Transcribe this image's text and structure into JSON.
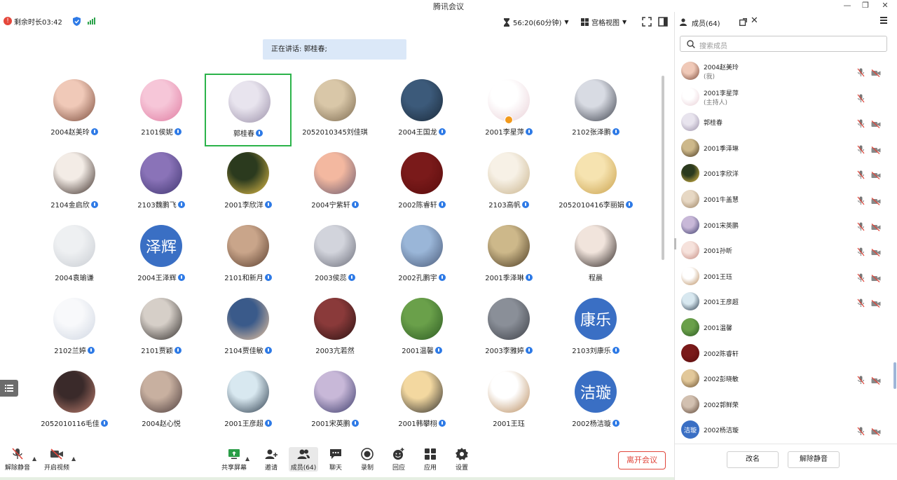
{
  "window": {
    "title": "腾讯会议"
  },
  "topbar": {
    "remaining": "剩余时长03:42",
    "duration": "56:20(60分钟)",
    "view_mode": "宫格视图"
  },
  "speaking": {
    "text": "正在讲话: 郭桂春;"
  },
  "grid": [
    {
      "name": "2004赵美玲",
      "colors": [
        "#f0c9b8",
        "#7a4a3a"
      ],
      "mic": true
    },
    {
      "name": "2101侯妮",
      "colors": [
        "#f6c6d8",
        "#e07aa0"
      ],
      "mic": true
    },
    {
      "name": "郭桂春",
      "colors": [
        "#e8e4ee",
        "#9a8fa8"
      ],
      "mic": true,
      "active": true
    },
    {
      "name": "2052010345刘佳琪",
      "colors": [
        "#d9c7a8",
        "#7c6a50"
      ],
      "mic": false
    },
    {
      "name": "2004王国龙",
      "colors": [
        "#3c5a7a",
        "#1b2a3a"
      ],
      "mic": true
    },
    {
      "name": "2001李星萍",
      "colors": [
        "#ffffff",
        "#e9cfd6"
      ],
      "mic": true,
      "host": true
    },
    {
      "name": "2102张泽鹏",
      "colors": [
        "#d8dbe3",
        "#3b3f4a"
      ],
      "mic": true
    },
    {
      "name": "2104金启欣",
      "colors": [
        "#f3ece6",
        "#3a2b26"
      ],
      "mic": true
    },
    {
      "name": "2103魏鹏飞",
      "colors": [
        "#8a73b8",
        "#3f3570"
      ],
      "mic": true
    },
    {
      "name": "2001李欣洋",
      "colors": [
        "#2b3a1e",
        "#e8c24a"
      ],
      "mic": true
    },
    {
      "name": "2004宁紫轩",
      "colors": [
        "#f3b8a0",
        "#6a5a6e"
      ],
      "mic": true
    },
    {
      "name": "2002陈睿轩",
      "colors": [
        "#7a1a1a",
        "#5a0d0d"
      ],
      "mic": true
    },
    {
      "name": "2103高帆",
      "colors": [
        "#f7f1e6",
        "#c8b28a"
      ],
      "mic": true
    },
    {
      "name": "2052010416李丽娟",
      "colors": [
        "#f6e3b0",
        "#c9a04a"
      ],
      "mic": true
    },
    {
      "name": "2004袁瑜谦",
      "colors": [
        "#eef0f2",
        "#c8ccd2"
      ],
      "mic": false
    },
    {
      "name": "2004王泽辉",
      "text": "泽辉",
      "mic": true
    },
    {
      "name": "2101和新月",
      "colors": [
        "#c9a58a",
        "#5a3e2e"
      ],
      "mic": true
    },
    {
      "name": "2003侯蕊",
      "colors": [
        "#d2d4dc",
        "#6a6c78"
      ],
      "mic": true
    },
    {
      "name": "2002孔鹏宇",
      "colors": [
        "#9ab6d8",
        "#4a5a78"
      ],
      "mic": true
    },
    {
      "name": "2001季泽琳",
      "colors": [
        "#cdb88a",
        "#4a3a22"
      ],
      "mic": true
    },
    {
      "name": "程晨",
      "colors": [
        "#f1e4dc",
        "#2a2220"
      ],
      "mic": false
    },
    {
      "name": "2102兰婷",
      "colors": [
        "#f8f9fb",
        "#cfd6e2"
      ],
      "mic": true
    },
    {
      "name": "2101贾颖",
      "colors": [
        "#d6cfc8",
        "#2e2a28"
      ],
      "mic": true
    },
    {
      "name": "2104贾佳敏",
      "colors": [
        "#3a5a8a",
        "#f0c8a0"
      ],
      "mic": true
    },
    {
      "name": "2003亢若然",
      "colors": [
        "#8a3a3a",
        "#2a1212"
      ],
      "mic": false
    },
    {
      "name": "2001温馨",
      "colors": [
        "#6aa04a",
        "#2c5a22"
      ],
      "mic": true
    },
    {
      "name": "2003李雅婷",
      "colors": [
        "#8a8f98",
        "#3c3f46"
      ],
      "mic": true
    },
    {
      "name": "2103刘康乐",
      "text": "康乐",
      "mic": true
    },
    {
      "name": "2052010116毛佳",
      "colors": [
        "#3a2a2a",
        "#c08070"
      ],
      "mic": true
    },
    {
      "name": "2004赵心悦",
      "colors": [
        "#c8b0a0",
        "#4a3a3a"
      ],
      "mic": false
    },
    {
      "name": "2001王彦超",
      "colors": [
        "#d8e8f0",
        "#2a3a4a"
      ],
      "mic": true
    },
    {
      "name": "2001宋英鹏",
      "colors": [
        "#c8b8d8",
        "#3a3a6a"
      ],
      "mic": true
    },
    {
      "name": "2001韩攀栩",
      "colors": [
        "#f3d8a0",
        "#2a2a2a"
      ],
      "mic": true
    },
    {
      "name": "2001王珏",
      "colors": [
        "#ffffff",
        "#b88a5a"
      ],
      "mic": false
    },
    {
      "name": "2002杨洁璇",
      "text": "洁璇",
      "mic": true
    }
  ],
  "bottombar": {
    "unmute": "解除静音",
    "video": "开启视频",
    "share": "共享屏幕",
    "invite": "邀请",
    "members": "成员(64)",
    "chat": "聊天",
    "record": "录制",
    "react": "回应",
    "apps": "应用",
    "settings": "设置",
    "leave": "离开会议"
  },
  "panel": {
    "title": "成员(64)",
    "search_placeholder": "搜索成员",
    "rename": "改名",
    "unmute_all": "解除静音",
    "members": [
      {
        "name": "2004赵美玲",
        "role": "(我)",
        "colors": [
          "#f0c9b8",
          "#7a4a3a"
        ],
        "mic": true,
        "cam": true
      },
      {
        "name": "2001李星萍",
        "role": "(主持人)",
        "colors": [
          "#ffffff",
          "#e9cfd6"
        ],
        "mic": true,
        "cam": false
      },
      {
        "name": "郭桂春",
        "colors": [
          "#e8e4ee",
          "#9a8fa8"
        ],
        "mic": true,
        "cam": true
      },
      {
        "name": "2001季泽琳",
        "colors": [
          "#cdb88a",
          "#4a3a22"
        ],
        "mic": true,
        "cam": true
      },
      {
        "name": "2001李欣洋",
        "colors": [
          "#2b3a1e",
          "#e8c24a"
        ],
        "mic": true,
        "cam": true
      },
      {
        "name": "2001牛盖慧",
        "colors": [
          "#e7d8c4",
          "#9a8060"
        ],
        "mic": true,
        "cam": true
      },
      {
        "name": "2001宋英鹏",
        "colors": [
          "#c8b8d8",
          "#3a3a6a"
        ],
        "mic": true,
        "cam": true
      },
      {
        "name": "2001孙昕",
        "colors": [
          "#f6e2dc",
          "#c48a80"
        ],
        "mic": true,
        "cam": true
      },
      {
        "name": "2001王珏",
        "colors": [
          "#ffffff",
          "#b88a5a"
        ],
        "mic": true,
        "cam": true
      },
      {
        "name": "2001王彦超",
        "colors": [
          "#d8e8f0",
          "#2a3a4a"
        ],
        "mic": true,
        "cam": true
      },
      {
        "name": "2001温馨",
        "colors": [
          "#6aa04a",
          "#2c5a22"
        ],
        "mic": false,
        "cam": false
      },
      {
        "name": "2002陈睿轩",
        "colors": [
          "#7a1a1a",
          "#5a0d0d"
        ],
        "mic": false,
        "cam": false
      },
      {
        "name": "2002彭晓敏",
        "colors": [
          "#e2c89a",
          "#6a5030"
        ],
        "mic": true,
        "cam": true
      },
      {
        "name": "2002郭鲜荣",
        "colors": [
          "#d2c0b0",
          "#5a4232"
        ],
        "mic": false,
        "cam": false
      },
      {
        "name": "2002杨洁璇",
        "text": "洁璇",
        "mic": true,
        "cam": true
      }
    ]
  }
}
